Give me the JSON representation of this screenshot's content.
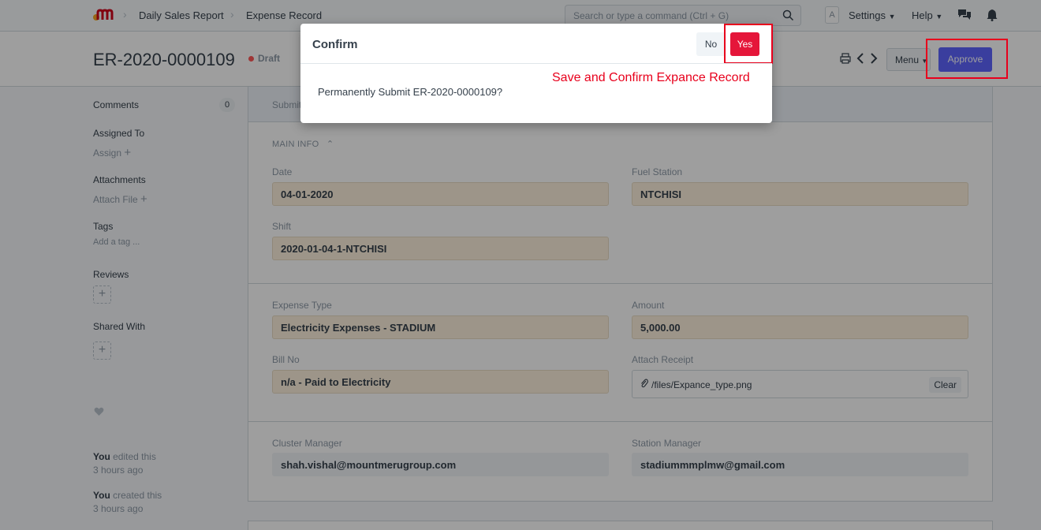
{
  "navbar": {
    "breadcrumbs": [
      "Daily Sales Report",
      "Expense Record"
    ],
    "search_placeholder": "Search or type a command (Ctrl + G)",
    "avatar_letter": "A",
    "settings_label": "Settings",
    "help_label": "Help"
  },
  "page": {
    "title": "ER-2020-0000109",
    "status": "Draft",
    "menu_label": "Menu",
    "approve_label": "Approve"
  },
  "sidebar": {
    "comments_label": "Comments",
    "comments_count": "0",
    "assigned_label": "Assigned To",
    "assign_action": "Assign",
    "attachments_label": "Attachments",
    "attach_action": "Attach File",
    "tags_label": "Tags",
    "tags_placeholder": "Add a tag ...",
    "reviews_label": "Reviews",
    "shared_label": "Shared With",
    "activity": [
      {
        "who": "You",
        "what": "edited this",
        "when": "3 hours ago"
      },
      {
        "who": "You",
        "what": "created this",
        "when": "3 hours ago"
      }
    ]
  },
  "form": {
    "top_text": "Submit",
    "section_title": "MAIN INFO",
    "date_label": "Date",
    "date_value": "04-01-2020",
    "fuel_station_label": "Fuel Station",
    "fuel_station_value": "NTCHISI",
    "shift_label": "Shift",
    "shift_value": "2020-01-04-1-NTCHISI",
    "expense_type_label": "Expense Type",
    "expense_type_value": "Electricity Expenses - STADIUM",
    "amount_label": "Amount",
    "amount_value": "5,000.00",
    "bill_no_label": "Bill No",
    "bill_no_value": "n/a - Paid to Electricity",
    "attach_receipt_label": "Attach Receipt",
    "attach_receipt_value": "/files/Expance_type.png",
    "clear_label": "Clear",
    "cluster_manager_label": "Cluster Manager",
    "cluster_manager_value": "shah.vishal@mountmerugroup.com",
    "station_manager_label": "Station Manager",
    "station_manager_value": "stadiummmplmw@gmail.com"
  },
  "modal": {
    "title": "Confirm",
    "no_label": "No",
    "yes_label": "Yes",
    "message": "Permanently Submit ER-2020-0000109?",
    "annotation": "Save and Confirm Expance Record"
  },
  "colors": {
    "primary": "#5e64ff",
    "danger": "#e5163a",
    "annotation": "#e8001c",
    "field_fill": "#fdf1dd"
  }
}
